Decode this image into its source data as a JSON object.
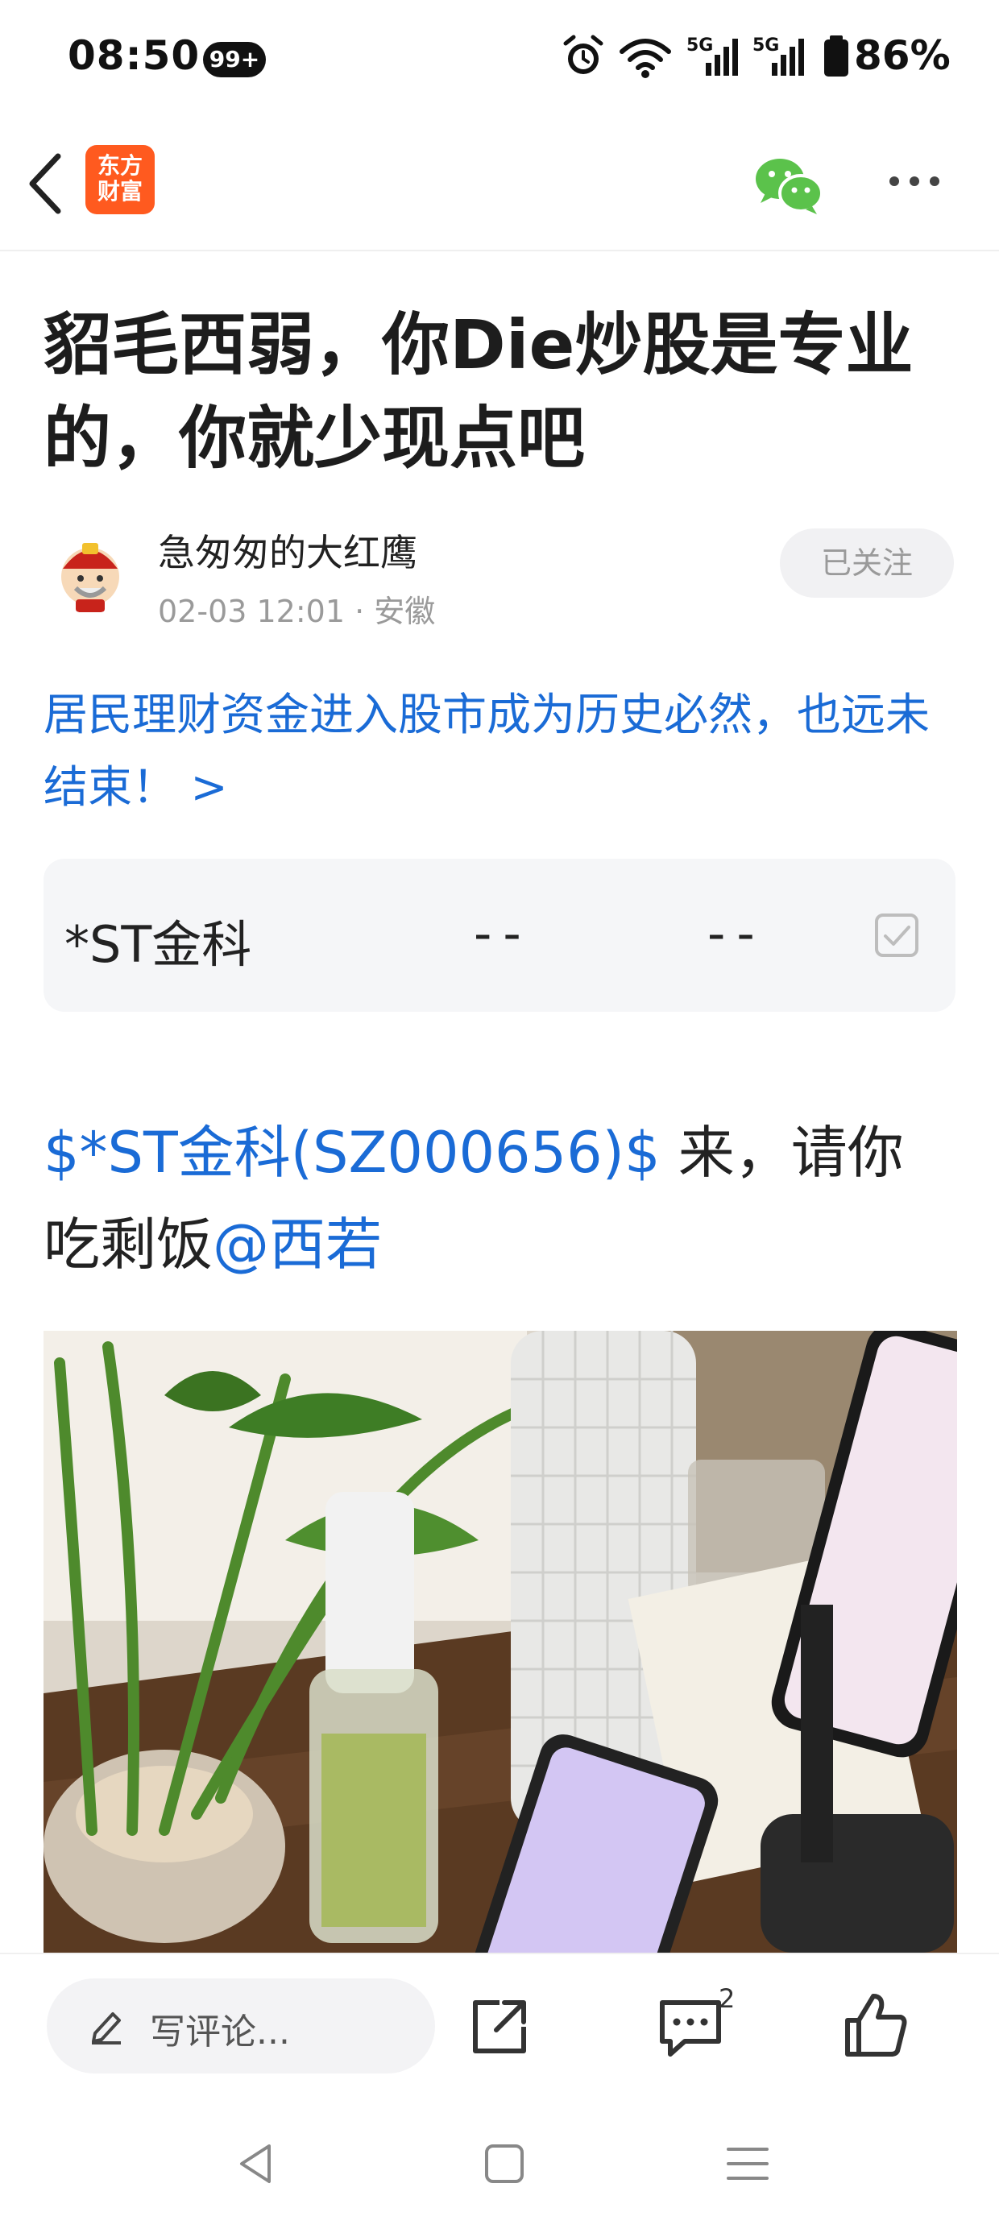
{
  "status_bar": {
    "time": "08:50",
    "notification_badge": "99+",
    "network_1": "5G",
    "network_2": "5G",
    "battery": "86%",
    "icons": [
      "alarm-icon",
      "wifi-icon",
      "signal-icon",
      "signal-icon",
      "battery-icon"
    ]
  },
  "header": {
    "logo_line1": "东方",
    "logo_line2": "财富",
    "icons": [
      "back-icon",
      "wechat-icon",
      "more-icon"
    ],
    "colors": {
      "logo": "#ff5a1f",
      "wechat": "#5bc24b"
    }
  },
  "article": {
    "title": "貂毛西弱，你Die炒股是专业的，你就少现点吧",
    "author_name": "急匆匆的大红鹰",
    "author_meta": "02-03 12:01 · 安徽",
    "follow_label": "已关注",
    "topic_link": "居民理财资金进入股市成为历史必然，也远未结束！ >",
    "stock_card": {
      "name": "*ST金科",
      "price": "--",
      "change": "--"
    },
    "body": {
      "stock_tag": "$*ST金科(SZ000656)$",
      "text": " 来，请你吃剩饭",
      "mention": "@西若"
    }
  },
  "bottom_bar": {
    "comment_placeholder": "写评论...",
    "comments_count": "2",
    "icons": [
      "edit-icon",
      "share-icon",
      "comments-icon",
      "like-icon"
    ]
  },
  "nav_bar": {
    "icons": [
      "nav-back-icon",
      "nav-home-icon",
      "nav-menu-icon"
    ]
  },
  "colors": {
    "link": "#1a6bd6",
    "muted": "#9a9a9a"
  }
}
